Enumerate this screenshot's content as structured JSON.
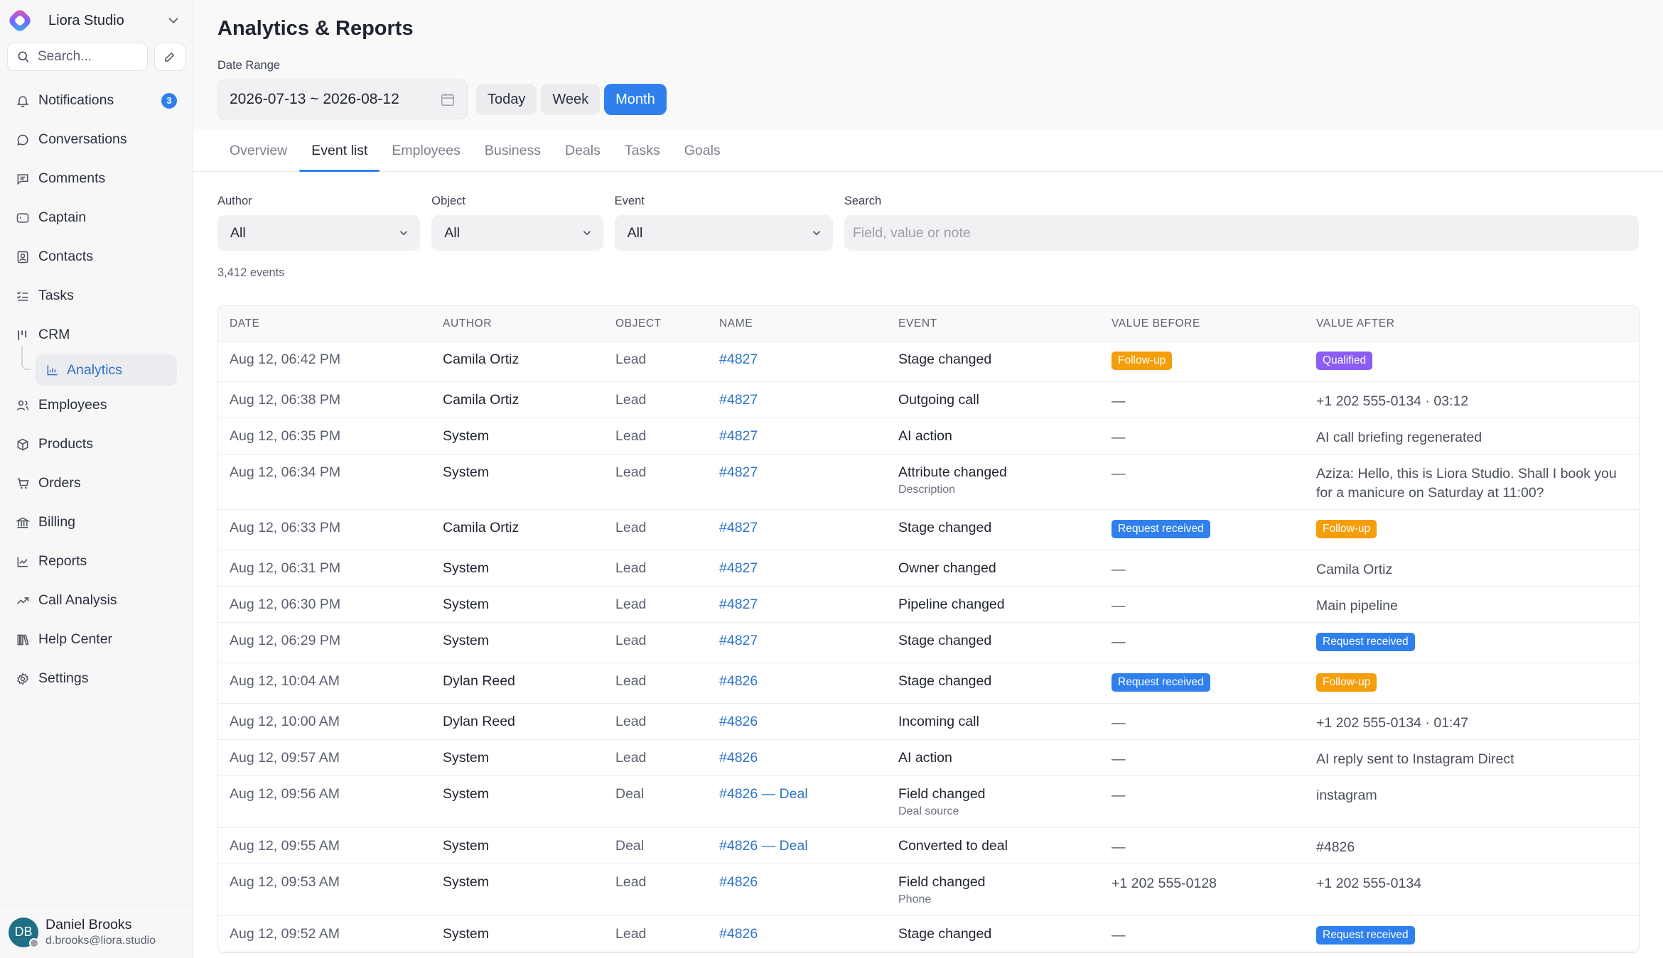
{
  "workspace": {
    "name": "Liora Studio"
  },
  "sidebar": {
    "search_placeholder": "Search...",
    "items": [
      {
        "label": "Notifications",
        "icon": "bell-icon",
        "count": "3"
      },
      {
        "label": "Conversations",
        "icon": "chat-bubble-icon"
      },
      {
        "label": "Comments",
        "icon": "comment-icon"
      },
      {
        "label": "Captain",
        "icon": "captain-icon"
      },
      {
        "label": "Contacts",
        "icon": "contacts-icon"
      },
      {
        "label": "Tasks",
        "icon": "tasks-icon"
      },
      {
        "label": "CRM",
        "icon": "crm-icon"
      },
      {
        "label": "Employees",
        "icon": "users-icon"
      },
      {
        "label": "Products",
        "icon": "box-icon"
      },
      {
        "label": "Orders",
        "icon": "cart-icon"
      },
      {
        "label": "Billing",
        "icon": "bank-icon"
      },
      {
        "label": "Reports",
        "icon": "line-chart-icon"
      },
      {
        "label": "Call Analysis",
        "icon": "trend-icon"
      },
      {
        "label": "Help Center",
        "icon": "books-icon"
      },
      {
        "label": "Settings",
        "icon": "gear-icon"
      }
    ],
    "crm_sub": {
      "label": "Analytics",
      "icon": "analytics-icon"
    }
  },
  "user": {
    "initials": "DB",
    "name": "Daniel Brooks",
    "email": "d.brooks@liora.studio"
  },
  "header": {
    "title": "Analytics & Reports",
    "date_range_label": "Date Range",
    "date_range_value": "2026-07-13 ~ 2026-08-12",
    "periods": [
      "Today",
      "Week",
      "Month"
    ],
    "active_period": "Month"
  },
  "tabs": [
    "Overview",
    "Event list",
    "Employees",
    "Business",
    "Deals",
    "Tasks",
    "Goals"
  ],
  "active_tab": "Event list",
  "filters": {
    "author": {
      "label": "Author",
      "value": "All"
    },
    "object": {
      "label": "Object",
      "value": "All"
    },
    "event": {
      "label": "Event",
      "value": "All"
    },
    "search": {
      "label": "Search",
      "placeholder": "Field, value or note"
    }
  },
  "event_count": "3,412 events",
  "colors": {
    "accent": "#2f80ed",
    "follow_up": "#f59e0b",
    "qualified": "#8b5cf6",
    "request_received": "#2f80ed"
  },
  "table": {
    "columns": [
      "DATE",
      "AUTHOR",
      "OBJECT",
      "NAME",
      "EVENT",
      "VALUE BEFORE",
      "VALUE AFTER"
    ],
    "rows": [
      {
        "date": "Aug 12, 06:42 PM",
        "author": "Camila Ortiz",
        "object": "Lead",
        "name": "#4827",
        "event": "Stage changed",
        "event_sub": "",
        "before": {
          "text": "Follow-up",
          "badge": "follow_up"
        },
        "after": {
          "text": "Qualified",
          "badge": "qualified"
        }
      },
      {
        "date": "Aug 12, 06:38 PM",
        "author": "Camila Ortiz",
        "object": "Lead",
        "name": "#4827",
        "event": "Outgoing call",
        "event_sub": "",
        "before": {
          "text": "—"
        },
        "after": {
          "text": "+1 202 555-0134 · 03:12"
        }
      },
      {
        "date": "Aug 12, 06:35 PM",
        "author": "System",
        "object": "Lead",
        "name": "#4827",
        "event": "AI action",
        "event_sub": "",
        "before": {
          "text": "—"
        },
        "after": {
          "text": "AI call briefing regenerated"
        }
      },
      {
        "date": "Aug 12, 06:34 PM",
        "author": "System",
        "object": "Lead",
        "name": "#4827",
        "event": "Attribute changed",
        "event_sub": "Description",
        "before": {
          "text": "—"
        },
        "after": {
          "text": "Aziza: Hello, this is Liora Studio. Shall I book you for a manicure on Saturday at 11:00?"
        }
      },
      {
        "date": "Aug 12, 06:33 PM",
        "author": "Camila Ortiz",
        "object": "Lead",
        "name": "#4827",
        "event": "Stage changed",
        "event_sub": "",
        "before": {
          "text": "Request received",
          "badge": "request_received"
        },
        "after": {
          "text": "Follow-up",
          "badge": "follow_up"
        }
      },
      {
        "date": "Aug 12, 06:31 PM",
        "author": "System",
        "object": "Lead",
        "name": "#4827",
        "event": "Owner changed",
        "event_sub": "",
        "before": {
          "text": "—"
        },
        "after": {
          "text": "Camila Ortiz"
        }
      },
      {
        "date": "Aug 12, 06:30 PM",
        "author": "System",
        "object": "Lead",
        "name": "#4827",
        "event": "Pipeline changed",
        "event_sub": "",
        "before": {
          "text": "—"
        },
        "after": {
          "text": "Main pipeline"
        }
      },
      {
        "date": "Aug 12, 06:29 PM",
        "author": "System",
        "object": "Lead",
        "name": "#4827",
        "event": "Stage changed",
        "event_sub": "",
        "before": {
          "text": "—"
        },
        "after": {
          "text": "Request received",
          "badge": "request_received"
        }
      },
      {
        "date": "Aug 12, 10:04 AM",
        "author": "Dylan Reed",
        "object": "Lead",
        "name": "#4826",
        "event": "Stage changed",
        "event_sub": "",
        "before": {
          "text": "Request received",
          "badge": "request_received"
        },
        "after": {
          "text": "Follow-up",
          "badge": "follow_up"
        }
      },
      {
        "date": "Aug 12, 10:00 AM",
        "author": "Dylan Reed",
        "object": "Lead",
        "name": "#4826",
        "event": "Incoming call",
        "event_sub": "",
        "before": {
          "text": "—"
        },
        "after": {
          "text": "+1 202 555-0134 · 01:47"
        }
      },
      {
        "date": "Aug 12, 09:57 AM",
        "author": "System",
        "object": "Lead",
        "name": "#4826",
        "event": "AI action",
        "event_sub": "",
        "before": {
          "text": "—"
        },
        "after": {
          "text": "AI reply sent to Instagram Direct"
        }
      },
      {
        "date": "Aug 12, 09:56 AM",
        "author": "System",
        "object": "Deal",
        "name": "#4826 — Deal",
        "event": "Field changed",
        "event_sub": "Deal source",
        "before": {
          "text": "—"
        },
        "after": {
          "text": "instagram"
        }
      },
      {
        "date": "Aug 12, 09:55 AM",
        "author": "System",
        "object": "Deal",
        "name": "#4826 — Deal",
        "event": "Converted to deal",
        "event_sub": "",
        "before": {
          "text": "—"
        },
        "after": {
          "text": "#4826"
        }
      },
      {
        "date": "Aug 12, 09:53 AM",
        "author": "System",
        "object": "Lead",
        "name": "#4826",
        "event": "Field changed",
        "event_sub": "Phone",
        "before": {
          "text": "+1 202 555-0128"
        },
        "after": {
          "text": "+1 202 555-0134"
        }
      },
      {
        "date": "Aug 12, 09:52 AM",
        "author": "System",
        "object": "Lead",
        "name": "#4826",
        "event": "Stage changed",
        "event_sub": "",
        "before": {
          "text": "—"
        },
        "after": {
          "text": "Request received",
          "badge": "request_received"
        }
      }
    ]
  }
}
